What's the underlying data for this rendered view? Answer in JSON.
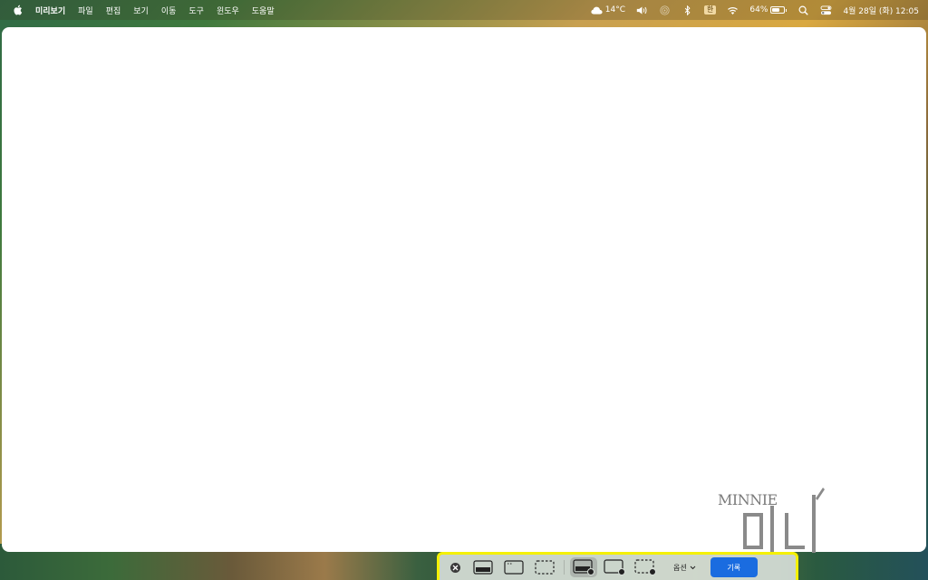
{
  "menubar": {
    "app_name": "미리보기",
    "menus": [
      "파일",
      "편집",
      "보기",
      "이동",
      "도구",
      "윈도우",
      "도움말"
    ],
    "weather_temp": "14°C",
    "input_source": "한",
    "battery_percent": "64%",
    "battery_level": 0.64,
    "datetime": "4월 28일 (화) 12:05"
  },
  "watermark": {
    "latin": "MINNIE"
  },
  "capture_toolbar": {
    "options_label": "옵션",
    "record_label": "기록",
    "accent_color": "#1a6ce0",
    "highlight_color": "#f4f000",
    "selected_tool": "record-entire-screen"
  }
}
